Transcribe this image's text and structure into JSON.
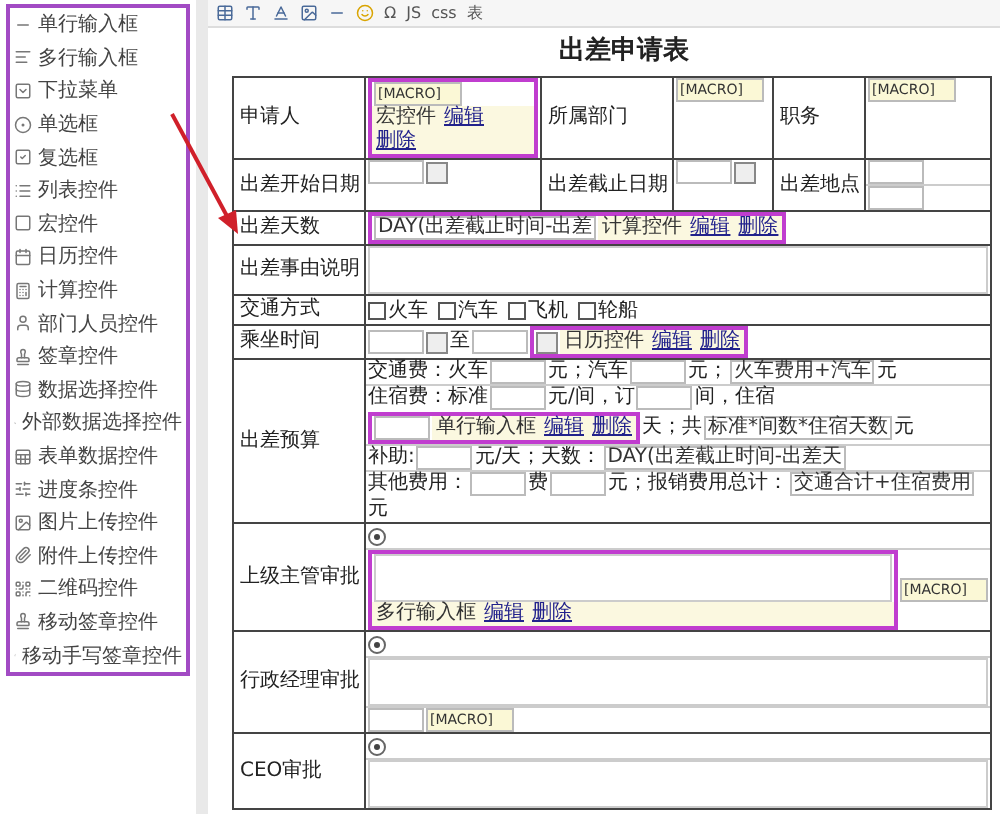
{
  "sidebar": {
    "items": [
      {
        "label": "单行输入框"
      },
      {
        "label": "多行输入框"
      },
      {
        "label": "下拉菜单"
      },
      {
        "label": "单选框"
      },
      {
        "label": "复选框"
      },
      {
        "label": "列表控件"
      },
      {
        "label": "宏控件"
      },
      {
        "label": "日历控件"
      },
      {
        "label": "计算控件"
      },
      {
        "label": "部门人员控件"
      },
      {
        "label": "签章控件"
      },
      {
        "label": "数据选择控件"
      },
      {
        "label": "外部数据选择控件"
      },
      {
        "label": "表单数据控件"
      },
      {
        "label": "进度条控件"
      },
      {
        "label": "图片上传控件"
      },
      {
        "label": "附件上传控件"
      },
      {
        "label": "二维码控件"
      },
      {
        "label": "移动签章控件"
      },
      {
        "label": "移动手写签章控件"
      }
    ]
  },
  "toolbar": {
    "items": [
      "Ω",
      "JS",
      "css",
      "表"
    ]
  },
  "title": "出差申请表",
  "form": {
    "header_rows": [
      {
        "cells": [
          {
            "label": "申请人"
          },
          {
            "lines": [
              [
                {
                  "kind": "control",
                  "name": "宏控件",
                  "actions": [
                    "编辑",
                    "删除"
                  ],
                  "content": [
                    {
                      "kind": "macro",
                      "value": "[MACRO]"
                    }
                  ]
                }
              ]
            ]
          },
          {
            "label": "所属部门"
          },
          {
            "lines": [
              [
                {
                  "kind": "macro",
                  "value": "[MACRO]"
                }
              ]
            ]
          },
          {
            "label": "职务"
          },
          {
            "lines": [
              [
                {
                  "kind": "macro",
                  "value": "[MACRO]"
                }
              ]
            ]
          }
        ]
      },
      {
        "cells": [
          {
            "label": "出差开始日期"
          },
          {
            "lines": [
              [
                {
                  "kind": "input"
                },
                {
                  "kind": "date"
                }
              ]
            ]
          },
          {
            "label": "出差截止日期"
          },
          {
            "lines": [
              [
                {
                  "kind": "input"
                },
                {
                  "kind": "date"
                }
              ]
            ]
          },
          {
            "label": "出差地点"
          },
          {
            "lines": [
              [
                {
                  "kind": "input"
                }
              ],
              [
                {
                  "kind": "input"
                }
              ]
            ]
          }
        ]
      }
    ],
    "rows": [
      {
        "cells": [
          {
            "label": "出差天数"
          },
          {
            "lines": [
              [
                {
                  "kind": "control",
                  "name": "计算控件",
                  "actions": [
                    "编辑",
                    "删除"
                  ],
                  "content": [
                    {
                      "kind": "input",
                      "value": "DAY(出差截止时间-出差"
                    }
                  ]
                }
              ]
            ]
          }
        ]
      },
      {
        "cells": [
          {
            "label": "出差事由说明"
          },
          {
            "lines": [
              [
                {
                  "kind": "textarea"
                }
              ]
            ]
          }
        ]
      },
      {
        "cells": [
          {
            "label": "交通方式"
          },
          {
            "lines": [
              [
                {
                  "kind": "check",
                  "label": "火车",
                  "checked": false
                },
                {
                  "kind": "check",
                  "label": "汽车",
                  "checked": false
                },
                {
                  "kind": "check",
                  "label": "飞机",
                  "checked": false
                },
                {
                  "kind": "check",
                  "label": "轮船",
                  "checked": false
                }
              ]
            ]
          }
        ]
      },
      {
        "cells": [
          {
            "label": "乘坐时间"
          },
          {
            "lines": [
              [
                {
                  "kind": "input"
                },
                {
                  "kind": "date"
                },
                {
                  "kind": "text",
                  "text": "至"
                },
                {
                  "kind": "input"
                },
                {
                  "kind": "control",
                  "name": "日历控件",
                  "actions": [
                    "编辑",
                    "删除"
                  ],
                  "content": [
                    {
                      "kind": "date"
                    }
                  ]
                }
              ]
            ]
          }
        ]
      },
      {
        "cells": [
          {
            "label": "出差预算"
          },
          {
            "lines": [
              [
                {
                  "kind": "text",
                  "text": "交通费：火车"
                },
                {
                  "kind": "input"
                },
                {
                  "kind": "text",
                  "text": "元；汽车"
                },
                {
                  "kind": "input"
                },
                {
                  "kind": "text",
                  "text": "元；"
                },
                {
                  "kind": "input",
                  "value": "火车费用+汽车"
                },
                {
                  "kind": "text",
                  "text": "元"
                }
              ],
              [
                {
                  "kind": "text",
                  "text": "住宿费：标准"
                },
                {
                  "kind": "input"
                },
                {
                  "kind": "text",
                  "text": "元/间，订"
                },
                {
                  "kind": "input"
                },
                {
                  "kind": "text",
                  "text": "间，住宿"
                },
                {
                  "kind": "control",
                  "name": "单行输入框",
                  "actions": [
                    "编辑",
                    "删除"
                  ],
                  "content": [
                    {
                      "kind": "input"
                    }
                  ]
                },
                {
                  "kind": "text",
                  "text": "天；共"
                },
                {
                  "kind": "input",
                  "value": "标准*间数*住宿天数"
                },
                {
                  "kind": "text",
                  "text": "元"
                }
              ],
              [
                {
                  "kind": "text",
                  "text": "补助:"
                },
                {
                  "kind": "input"
                },
                {
                  "kind": "text",
                  "text": "元/天；天数："
                },
                {
                  "kind": "input",
                  "value": "DAY(出差截止时间-出差天"
                }
              ],
              [
                {
                  "kind": "text",
                  "text": "其他费用："
                },
                {
                  "kind": "input"
                },
                {
                  "kind": "text",
                  "text": "费"
                },
                {
                  "kind": "input"
                },
                {
                  "kind": "text",
                  "text": "元；报销费用总计："
                },
                {
                  "kind": "input",
                  "value": "交通合计+住宿费用"
                },
                {
                  "kind": "text",
                  "text": "元"
                }
              ]
            ]
          }
        ]
      },
      {
        "cells": [
          {
            "label": "上级主管审批"
          },
          {
            "lines": [
              [
                {
                  "kind": "radio",
                  "selected": true
                }
              ],
              [
                {
                  "kind": "control",
                  "name": "多行输入框",
                  "actions": [
                    "编辑",
                    "删除"
                  ],
                  "content": [
                    {
                      "kind": "textarea"
                    }
                  ]
                },
                {
                  "kind": "macro",
                  "value": "[MACRO]"
                }
              ]
            ]
          }
        ]
      },
      {
        "cells": [
          {
            "label": "行政经理审批"
          },
          {
            "lines": [
              [
                {
                  "kind": "radio",
                  "selected": true
                }
              ],
              [
                {
                  "kind": "textarea"
                }
              ],
              [
                {
                  "kind": "input"
                },
                {
                  "kind": "macro",
                  "value": "[MACRO]"
                }
              ]
            ]
          }
        ]
      },
      {
        "cells": [
          {
            "label": "CEO审批"
          },
          {
            "lines": [
              [
                {
                  "kind": "radio",
                  "selected": true
                }
              ],
              [
                {
                  "kind": "textarea"
                }
              ]
            ]
          }
        ]
      }
    ]
  }
}
